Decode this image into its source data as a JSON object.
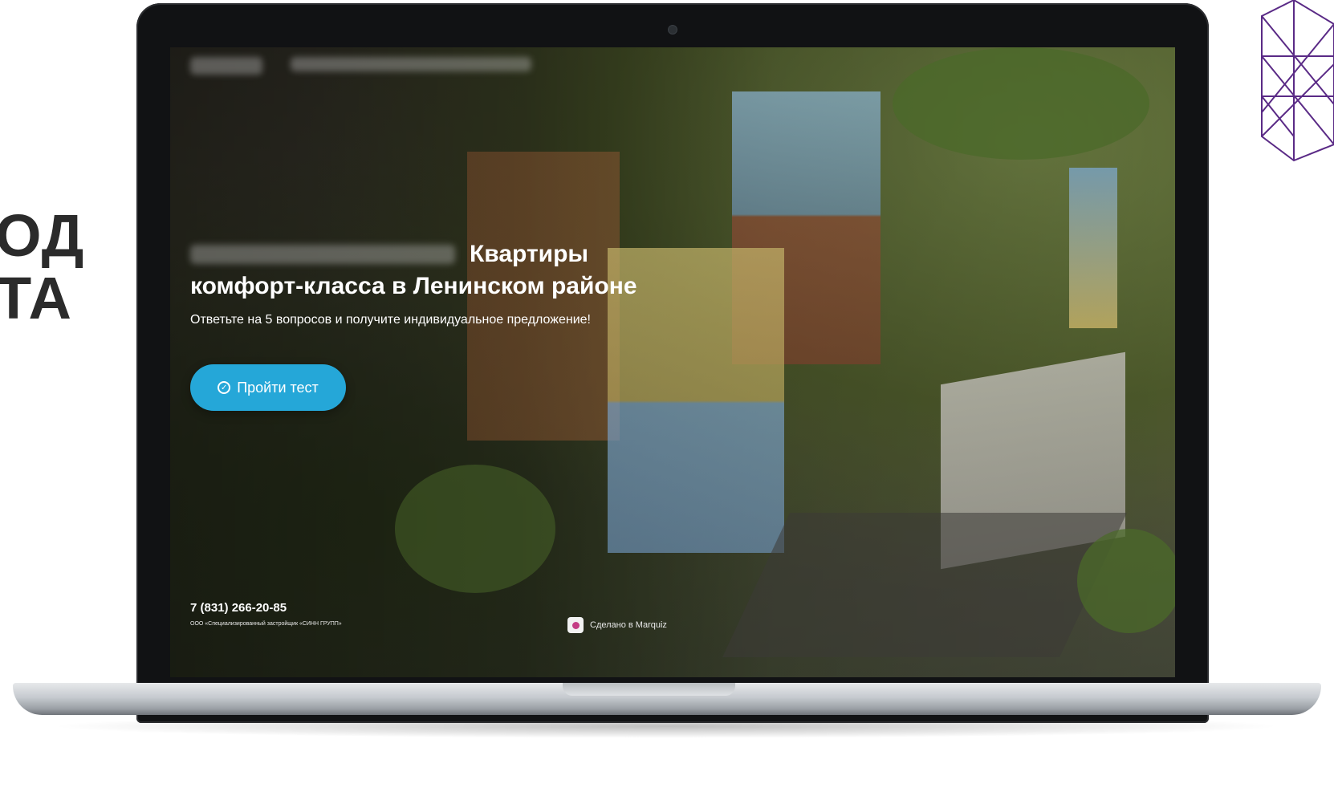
{
  "side": {
    "line1": "ОД",
    "line2": "ТА"
  },
  "hero": {
    "title_line1": "Квартиры",
    "title_line2": "комфорт-класса в Ленинском районе",
    "subtitle": "Ответьте на 5 вопросов и получите индивидуальное предложение!",
    "cta_label": "Пройти тест"
  },
  "footer": {
    "phone": "7 (831) 266-20-85",
    "company": "ООО «Специализированный застройщик «СИНН ГРУПП»",
    "made_with": "Сделано в Marquiz"
  },
  "colors": {
    "cta": "#25a7d8",
    "side_text": "#2b2b2b",
    "geo_lines": "#5a2a86",
    "marquiz_logo": "#c43d85"
  },
  "icons": {
    "cta": "check-circle-icon",
    "made_with": "marquiz-logo-icon"
  }
}
